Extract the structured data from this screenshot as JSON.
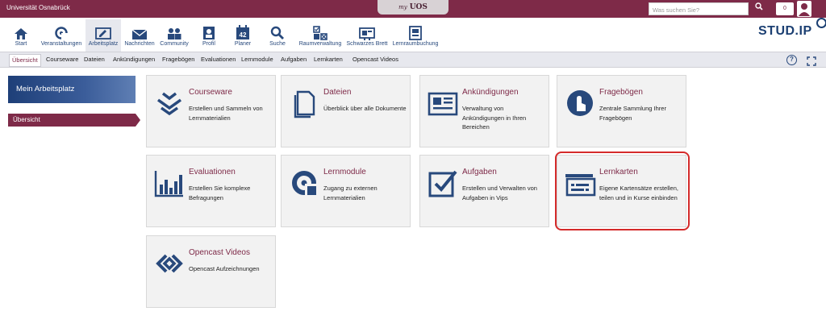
{
  "topbar": {
    "university": "Universität Osnabrück",
    "logo_prefix": "my",
    "logo_text": "UOS",
    "search_placeholder": "Was suchen Sie?",
    "notification_count": "0"
  },
  "nav": {
    "items": [
      {
        "label": "Start",
        "icon": "home-icon"
      },
      {
        "label": "Veranstaltungen",
        "icon": "seminar-icon"
      },
      {
        "label": "Arbeitsplatz",
        "icon": "workplace-icon"
      },
      {
        "label": "Nachrichten",
        "icon": "mail-icon"
      },
      {
        "label": "Community",
        "icon": "community-icon"
      },
      {
        "label": "Profil",
        "icon": "profile-icon"
      },
      {
        "label": "Planer",
        "icon": "calendar-icon"
      },
      {
        "label": "Suche",
        "icon": "search-icon"
      },
      {
        "label": "Raumverwaltung",
        "icon": "room-icon"
      },
      {
        "label": "Schwarzes Brett",
        "icon": "board-icon"
      },
      {
        "label": "Lernraumbuchung",
        "icon": "booking-icon"
      }
    ],
    "calendar_day": "42",
    "brand": "STUD.IP"
  },
  "subnav": {
    "tabs": [
      "Übersicht",
      "Courseware",
      "Dateien",
      "Ankündigungen",
      "Fragebögen",
      "Evaluationen",
      "Lernmodule",
      "Aufgaben",
      "Lernkarten",
      "Opencast Videos"
    ],
    "help_label": "?"
  },
  "sidebar": {
    "title": "Mein Arbeitsplatz",
    "item": "Übersicht"
  },
  "tiles": [
    {
      "title": "Courseware",
      "desc": "Erstellen und Sammeln von Lernmaterialien",
      "icon": "courseware-icon"
    },
    {
      "title": "Dateien",
      "desc": "Überblick über alle Dokumente",
      "icon": "files-icon"
    },
    {
      "title": "Ankündigungen",
      "desc": "Verwaltung von Ankündigungen in Ihren Bereichen",
      "icon": "news-icon"
    },
    {
      "title": "Fragebögen",
      "desc": "Zentrale Sammlung Ihrer Fragebögen",
      "icon": "vote-icon"
    },
    {
      "title": "Evaluationen",
      "desc": "Erstellen Sie komplexe Befragungen",
      "icon": "evaluation-icon"
    },
    {
      "title": "Lernmodule",
      "desc": "Zugang zu externen Lernmaterialien",
      "icon": "learnmodule-icon"
    },
    {
      "title": "Aufgaben",
      "desc": "Erstellen und Verwalten von Aufgaben in Vips",
      "icon": "tasks-icon"
    },
    {
      "title": "Lernkarten",
      "desc": "Eigene Kartensätze erstellen, teilen und in Kurse einbinden",
      "icon": "flashcards-icon"
    },
    {
      "title": "Opencast Videos",
      "desc": "Opencast Aufzeichnungen",
      "icon": "opencast-icon"
    }
  ],
  "colors": {
    "brand": "#7e2a48",
    "accent": "#28497c",
    "highlight": "#d42a2a"
  }
}
